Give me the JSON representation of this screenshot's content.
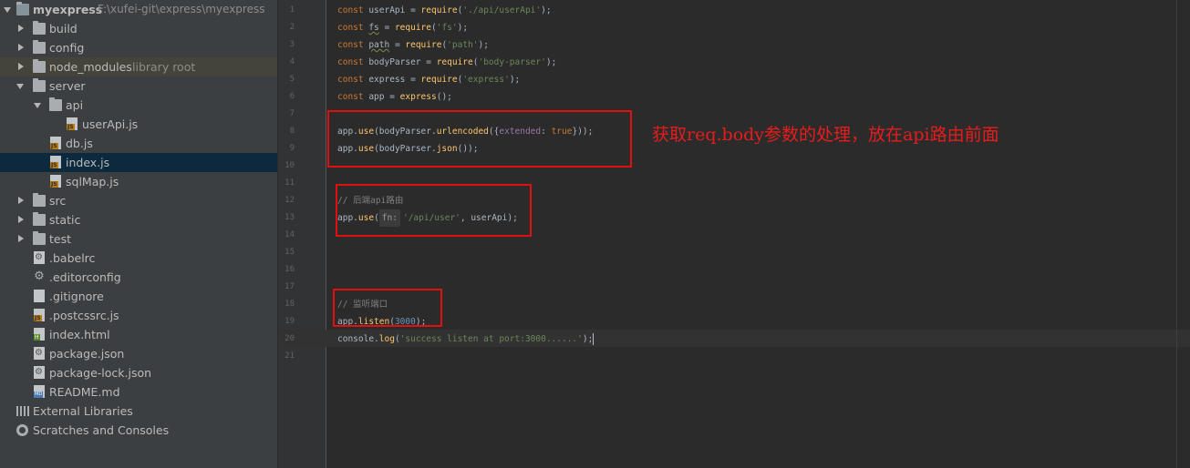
{
  "project": {
    "name": "myexpress",
    "path": "F:\\xufei-git\\express\\myexpress"
  },
  "tree": {
    "build": "build",
    "config": "config",
    "node_modules": "node_modules",
    "node_modules_hint": "library root",
    "server": "server",
    "api": "api",
    "userApi": "userApi.js",
    "db": "db.js",
    "index_js": "index.js",
    "sqlMap": "sqlMap.js",
    "src": "src",
    "static": "static",
    "test": "test",
    "babelrc": ".babelrc",
    "editorconfig": ".editorconfig",
    "gitignore": ".gitignore",
    "postcssrc": ".postcssrc.js",
    "index_html": "index.html",
    "package_json": "package.json",
    "package_lock": "package-lock.json",
    "readme": "README.md",
    "external_libraries": "External Libraries",
    "scratches": "Scratches and Consoles"
  },
  "gutter": [
    "1",
    "2",
    "3",
    "4",
    "5",
    "6",
    "7",
    "8",
    "9",
    "10",
    "11",
    "12",
    "13",
    "14",
    "15",
    "16",
    "17",
    "18",
    "19",
    "20",
    "21"
  ],
  "code": {
    "l1": {
      "const": "const ",
      "var": "userApi",
      "eq": " = ",
      "req": "require",
      "open": "(",
      "str": "'./api/userApi'",
      "close": ");"
    },
    "l2": {
      "const": "const ",
      "var": "fs",
      "eq": " = ",
      "req": "require",
      "open": "(",
      "str": "'fs'",
      "close": ");"
    },
    "l3": {
      "const": "const ",
      "var": "path",
      "eq": " = ",
      "req": "require",
      "open": "(",
      "str": "'path'",
      "close": ");"
    },
    "l4": {
      "const": "const ",
      "var": "bodyParser",
      "eq": " = ",
      "req": "require",
      "open": "(",
      "str": "'body-parser'",
      "close": ");"
    },
    "l5": {
      "const": "const ",
      "var": "express",
      "eq": " = ",
      "req": "require",
      "open": "(",
      "str": "'express'",
      "close": ");"
    },
    "l6": {
      "const": "const ",
      "var": "app",
      "eq": " = ",
      "call": "express",
      "close": "();"
    },
    "l8": {
      "obj": "app.",
      "fn": "use",
      "a": "(bodyParser.",
      "b": "urlencoded",
      "c": "({",
      "key": "extended",
      "colon": ": ",
      "val": "true",
      "d": "}));"
    },
    "l9": {
      "obj": "app.",
      "fn": "use",
      "a": "(bodyParser.",
      "b": "json",
      "c": "());"
    },
    "l12": {
      "comment": "// 后端api路由"
    },
    "l13": {
      "obj": "app.",
      "fn": "use",
      "open": "(",
      "hint": "fn:",
      "str": "'/api/user'",
      "rest": ", userApi);"
    },
    "l18": {
      "comment": "// 监听端口"
    },
    "l19": {
      "obj": "app.",
      "fn": "listen",
      "open": "(",
      "num": "3000",
      "close": ");"
    },
    "l20": {
      "obj": "console.",
      "fn": "log",
      "open": "(",
      "str": "'success listen at port:3000......'",
      "close": ");"
    }
  },
  "annotation": {
    "text": "获取req.body参数的处理，放在api路由前面"
  }
}
